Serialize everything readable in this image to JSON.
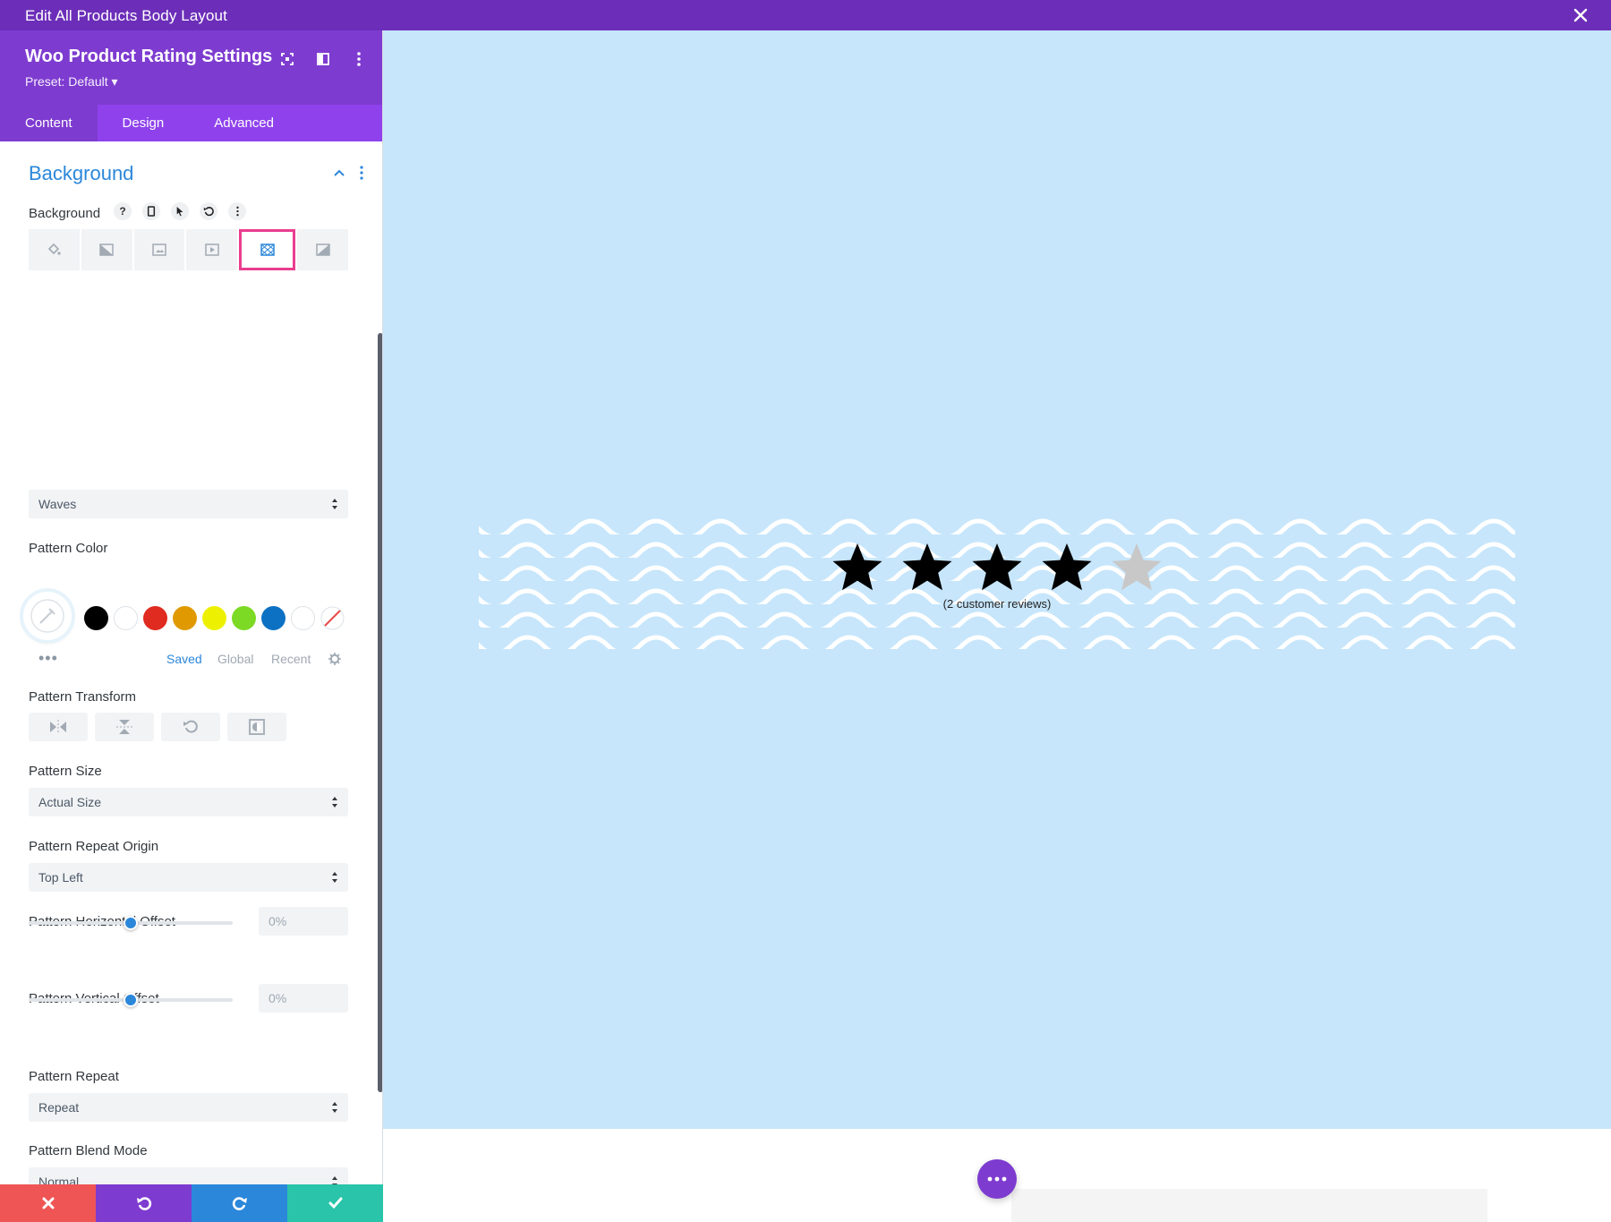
{
  "window": {
    "title": "Edit All Products Body Layout"
  },
  "panel": {
    "title": "Woo Product Rating Settings",
    "preset": "Preset: Default ▾",
    "tabs": [
      {
        "label": "Content",
        "active": true
      },
      {
        "label": "Design",
        "active": false
      },
      {
        "label": "Advanced",
        "active": false
      }
    ],
    "section_title": "Background",
    "background_label": "Background",
    "background_help_icon": "?",
    "background_types": [
      "color-icon",
      "gradient-icon",
      "image-icon",
      "video-icon",
      "pattern-icon",
      "mask-icon"
    ],
    "selected_background_type": "pattern-icon",
    "pattern_select": "Waves",
    "pattern_color_label": "Pattern Color",
    "swatches": [
      "#000000",
      "#ffffff",
      "#e02b20",
      "#e09900",
      "#edf000",
      "#7cda24",
      "#0c71c3",
      "#ffffff"
    ],
    "swatch_tabs": {
      "saved": "Saved",
      "global": "Global",
      "recent": "Recent"
    },
    "pattern_transform_label": "Pattern Transform",
    "pattern_size_label": "Pattern Size",
    "pattern_size_value": "Actual Size",
    "pattern_repeat_origin_label": "Pattern Repeat Origin",
    "pattern_repeat_origin_value": "Top Left",
    "h_offset_label": "Pattern Horizontal Offset",
    "h_offset_value": "0%",
    "v_offset_label": "Pattern Vertical Offset",
    "v_offset_value": "0%",
    "h_offset_fraction": 0.5,
    "v_offset_fraction": 0.5,
    "pattern_repeat_label": "Pattern Repeat",
    "pattern_repeat_value": "Repeat",
    "blend_mode_label": "Pattern Blend Mode",
    "blend_mode_value": "Normal"
  },
  "footer": {
    "colors": {
      "discard": "#ef5555",
      "undo": "#7e3bd0",
      "redo": "#2b87da",
      "save": "#29c4a9"
    }
  },
  "canvas": {
    "background": "#c7e6fb",
    "rating": {
      "filled_stars": 4,
      "total_stars": 5
    },
    "reviews_text": "(2 customer reviews)"
  }
}
